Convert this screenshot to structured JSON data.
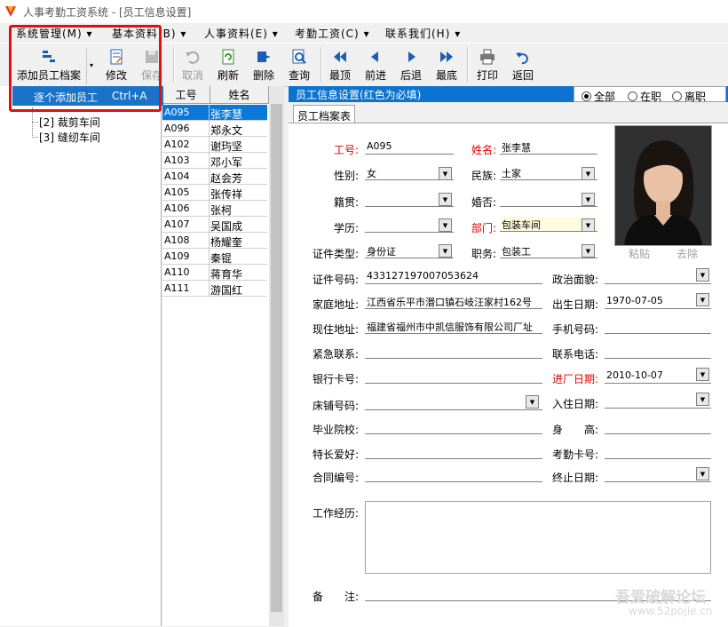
{
  "window": {
    "title": "人事考勤工资系统 - [员工信息设置]"
  },
  "menu": [
    {
      "label": "系统管理(M)"
    },
    {
      "label": "基本资料(B)"
    },
    {
      "label": "人事资料(E)"
    },
    {
      "label": "考勤工资(C)"
    },
    {
      "label": "联系我们(H)"
    }
  ],
  "toolbar": {
    "add": "添加员工档案",
    "edit": "修改",
    "save": "保存",
    "cancel": "取消",
    "refresh": "刷新",
    "delete": "删除",
    "query": "查询",
    "first": "最顶",
    "prev": "前进",
    "next": "后退",
    "last": "最底",
    "print": "打印",
    "back": "返回"
  },
  "dropdown": {
    "item": "逐个添加员工",
    "shortcut": "Ctrl+A"
  },
  "tree": [
    {
      "label": "[2] 裁剪车间"
    },
    {
      "label": "[3] 缝纫车间"
    }
  ],
  "list": {
    "col_id": "工号",
    "col_name": "姓名",
    "rows": [
      {
        "id": "A095",
        "name": "张李慧"
      },
      {
        "id": "A096",
        "name": "郑永文"
      },
      {
        "id": "A102",
        "name": "谢玙坚"
      },
      {
        "id": "A103",
        "name": "邓小军"
      },
      {
        "id": "A104",
        "name": "赵会芳"
      },
      {
        "id": "A105",
        "name": "张传祥"
      },
      {
        "id": "A106",
        "name": "张柯"
      },
      {
        "id": "A107",
        "name": "吴国成"
      },
      {
        "id": "A108",
        "name": "杨耀奎"
      },
      {
        "id": "A109",
        "name": "秦锟"
      },
      {
        "id": "A110",
        "name": "蒋育华"
      },
      {
        "id": "A111",
        "name": "游国红"
      }
    ]
  },
  "form": {
    "header": "员工信息设置(红色为必填)",
    "radios": {
      "all": "全部",
      "active": "在职",
      "left": "离职"
    },
    "tab": "员工档案表",
    "labels": {
      "emp_no": "工号:",
      "name": "姓名:",
      "gender": "性别:",
      "ethnic": "民族:",
      "native": "籍贯:",
      "marital": "婚否:",
      "education": "学历:",
      "dept": "部门:",
      "id_type": "证件类型:",
      "position": "职务:",
      "id_no": "证件号码:",
      "political": "政治面貌:",
      "home_addr": "家庭地址:",
      "birth": "出生日期:",
      "current_addr": "现住地址:",
      "mobile": "手机号码:",
      "emergency": "紧急联系:",
      "contact_phone": "联系电话:",
      "bank": "银行卡号:",
      "join_date": "进厂日期:",
      "bed": "床铺号码:",
      "checkin": "入住日期:",
      "school": "毕业院校:",
      "height": "身　　高:",
      "hobby": "特长爱好:",
      "attendance_card": "考勤卡号:",
      "contract": "合同编号:",
      "end_date": "终止日期:",
      "experience": "工作经历:",
      "remark": "备　　注:"
    },
    "values": {
      "emp_no": "A095",
      "name": "张李慧",
      "gender": "女",
      "ethnic": "土家",
      "dept": "包装车间",
      "id_type": "身份证",
      "position": "包装工",
      "id_no": "433127197007053624",
      "home_addr": "江西省乐平市湣口镇石岐汪家村162号",
      "birth": "1970-07-05",
      "current_addr": "福建省福州市中凯信服饰有限公司厂址",
      "join_date": "2010-10-07"
    },
    "photo": {
      "paste": "粘贴",
      "remove": "去除"
    }
  },
  "watermark": {
    "line1": "吾爱破解论坛",
    "line2": "www.52pojie.cn"
  },
  "colors": {
    "selection": "#0b78d7",
    "header": "#0c73d0",
    "required": "#e00000",
    "highlight": "#e01010"
  }
}
